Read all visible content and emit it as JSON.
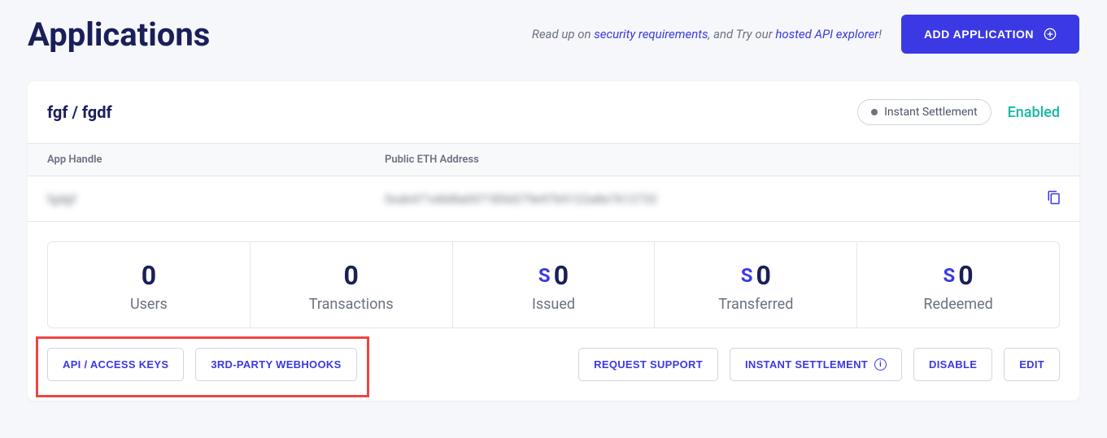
{
  "page": {
    "title": "Applications"
  },
  "header": {
    "readup_prefix": "Read up on ",
    "security_link": "security requirements",
    "tryout_mid": ", and Try our ",
    "api_link": "hosted API explorer",
    "suffix": "!",
    "add_button": "ADD APPLICATION"
  },
  "card": {
    "app_name": "fgf / fgdf",
    "pill_label": "Instant Settlement",
    "status": "Enabled"
  },
  "table": {
    "col1": "App Handle",
    "col2": "Public ETH Address",
    "handle_value": "fgdgf",
    "eth_value": "0xab471e8d8a0071B5d279e97b9122a8e7612732"
  },
  "stats": [
    {
      "value": "0",
      "label": "Users",
      "prefix": ""
    },
    {
      "value": "0",
      "label": "Transactions",
      "prefix": ""
    },
    {
      "value": "0",
      "label": "Issued",
      "prefix": "S"
    },
    {
      "value": "0",
      "label": "Transferred",
      "prefix": "S"
    },
    {
      "value": "0",
      "label": "Redeemed",
      "prefix": "S"
    }
  ],
  "actions": {
    "api_keys": "API / ACCESS KEYS",
    "webhooks": "3RD-PARTY WEBHOOKS",
    "request_support": "REQUEST SUPPORT",
    "instant_settlement": "INSTANT SETTLEMENT",
    "disable": "DISABLE",
    "edit": "EDIT"
  }
}
